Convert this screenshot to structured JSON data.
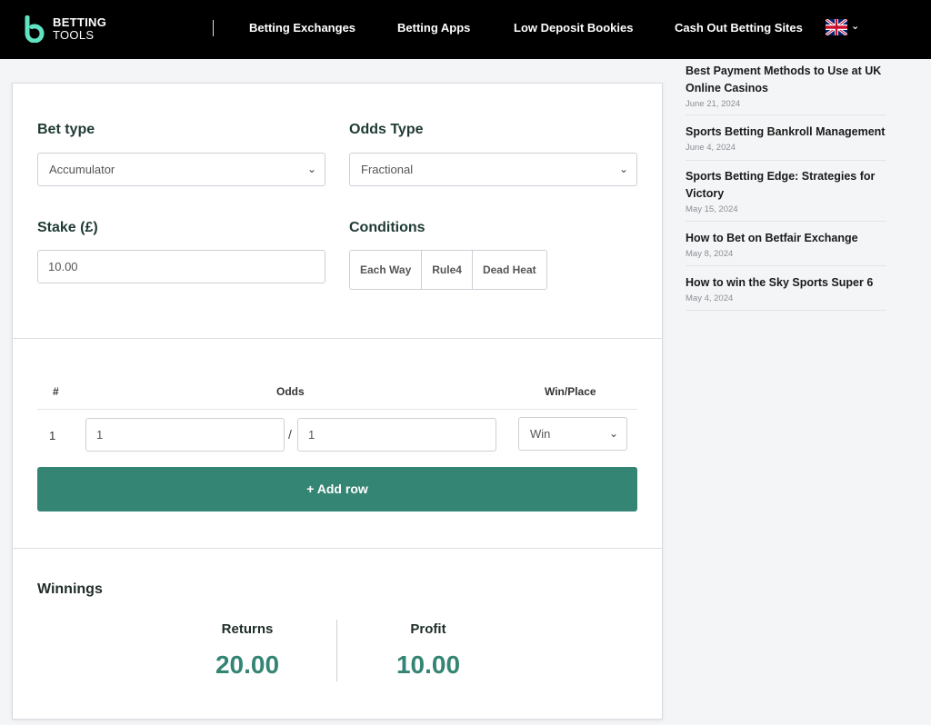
{
  "header": {
    "logo_line1": "BETTING",
    "logo_line2": "TOOLS",
    "nav": [
      {
        "label": "Betting Exchanges"
      },
      {
        "label": "Betting Apps"
      },
      {
        "label": "Low Deposit Bookies"
      },
      {
        "label": "Cash Out Betting Sites"
      }
    ],
    "language_icon": "uk-flag-icon"
  },
  "calculator": {
    "bet_type_label": "Bet type",
    "bet_type_value": "Accumulator",
    "odds_type_label": "Odds Type",
    "odds_type_value": "Fractional",
    "stake_label": "Stake (£)",
    "stake_value": "10.00",
    "conditions_label": "Conditions",
    "conditions": [
      "Each Way",
      "Rule4",
      "Dead Heat"
    ],
    "table_headers": {
      "num": "#",
      "odds": "Odds",
      "win_place": "Win/Place"
    },
    "rows": [
      {
        "num": "1",
        "odds_num": "1",
        "odds_den": "1",
        "win_place": "Win"
      }
    ],
    "slash": "/",
    "add_row_label": "+ Add row",
    "winnings_title": "Winnings",
    "returns_label": "Returns",
    "returns_value": "20.00",
    "profit_label": "Profit",
    "profit_value": "10.00"
  },
  "sidebar": {
    "articles": [
      {
        "title": "Best Payment Methods to Use at UK Online Casinos",
        "date": "June 21, 2024"
      },
      {
        "title": "Sports Betting Bankroll Management",
        "date": "June 4, 2024"
      },
      {
        "title": "Sports Betting Edge: Strategies for Victory",
        "date": "May 15, 2024"
      },
      {
        "title": "How to Bet on Betfair Exchange",
        "date": "May 8, 2024"
      },
      {
        "title": "How to win the Sky Sports Super 6",
        "date": "May 4, 2024"
      }
    ]
  },
  "colors": {
    "accent": "#358574",
    "header_bg": "#000000"
  }
}
